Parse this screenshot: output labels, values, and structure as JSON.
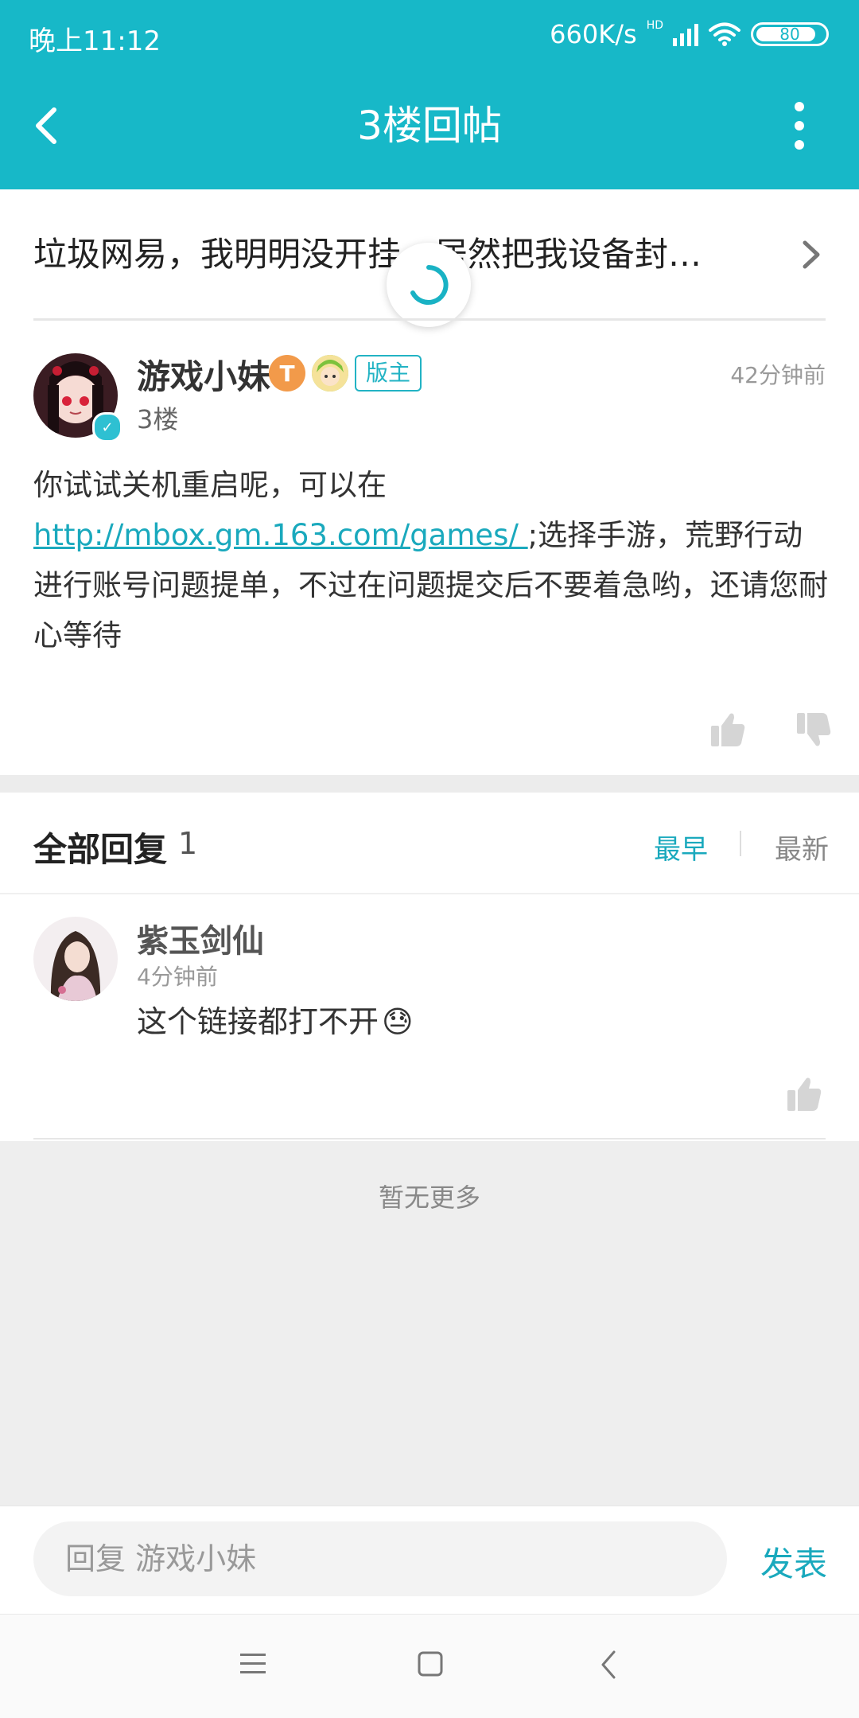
{
  "status_bar": {
    "time": "晚上11:12",
    "network_speed": "660K/s",
    "network_type": "HD",
    "battery": "80"
  },
  "app_bar": {
    "title": "3楼回帖",
    "back_icon": "chevron-left-icon",
    "more_icon": "more-vertical-icon"
  },
  "thread": {
    "title": "垃圾网易，我明明没开挂，居然把我设备封…"
  },
  "post": {
    "author": "游戏小妹",
    "level_badge": "T",
    "moderator_tag": "版主",
    "floor": "3楼",
    "time": "42分钟前",
    "text_before_link": "你试试关机重启呢，可以在",
    "link": "http://mbox.gm.163.com/games/ ",
    "text_after_link": ";选择手游，荒野行动进行账号问题提单，不过在问题提交后不要着急哟，还请您耐心等待"
  },
  "replies_header": {
    "label": "全部回复",
    "count": "1",
    "sort_earliest": "最早",
    "sort_latest": "最新",
    "active_sort": "最早"
  },
  "replies": [
    {
      "author": "紫玉剑仙",
      "time": "4分钟前",
      "text": "这个链接都打不开",
      "emoji": "😓"
    }
  ],
  "end_text": "暂无更多",
  "reply_bar": {
    "placeholder": "回复 游戏小妹",
    "publish_label": "发表"
  },
  "colors": {
    "accent": "#17b8c8",
    "link": "#1aa9bd",
    "moderator": "#22b3c4",
    "level_badge": "#f29a4a"
  }
}
